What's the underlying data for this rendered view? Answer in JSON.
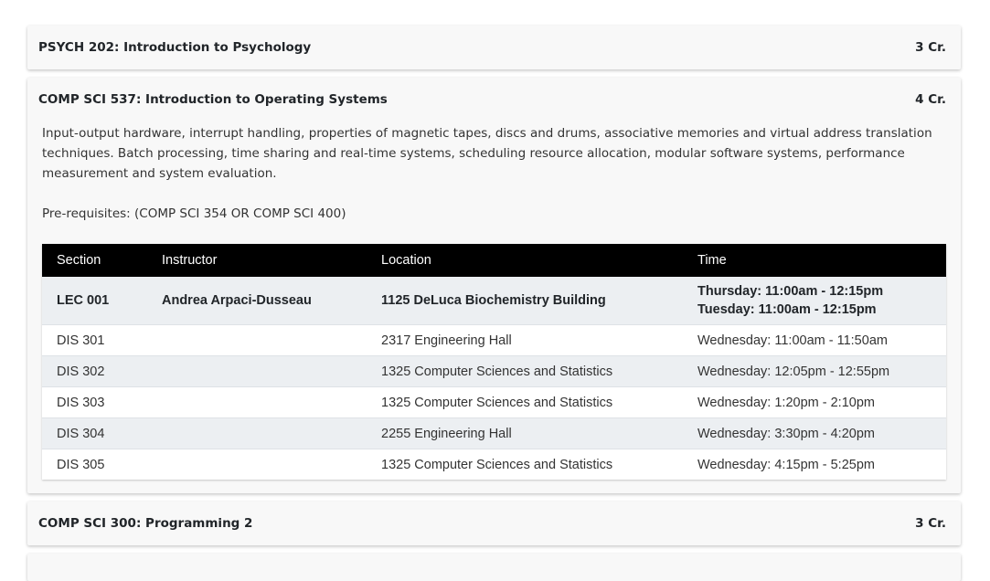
{
  "courses": [
    {
      "title": "PSYCH 202: Introduction to Psychology",
      "credits": "3 Cr."
    },
    {
      "title": "COMP SCI 537: Introduction to Operating Systems",
      "credits": "4 Cr.",
      "description": "Input-output hardware, interrupt handling, properties of magnetic tapes, discs and drums, associative memories and virtual address translation techniques. Batch processing, time sharing and real-time systems, scheduling resource allocation, modular software systems, performance measurement and system evaluation.",
      "prerequisites": "Pre-requisites: (COMP SCI 354 OR COMP SCI 400)"
    },
    {
      "title": "COMP SCI 300: Programming 2",
      "credits": "3 Cr."
    }
  ],
  "table": {
    "headers": {
      "section": "Section",
      "instructor": "Instructor",
      "location": "Location",
      "time": "Time"
    },
    "lecture": {
      "section": "LEC 001",
      "instructor": "Andrea Arpaci-Dusseau",
      "location": "1125 DeLuca Biochemistry Building",
      "times": [
        "Thursday: 11:00am - 12:15pm",
        "Tuesday: 11:00am - 12:15pm"
      ]
    },
    "rows": [
      {
        "section": "DIS 301",
        "instructor": "",
        "location": "2317 Engineering Hall",
        "time": "Wednesday: 11:00am - 11:50am"
      },
      {
        "section": "DIS 302",
        "instructor": "",
        "location": "1325 Computer Sciences and Statistics",
        "time": "Wednesday: 12:05pm - 12:55pm"
      },
      {
        "section": "DIS 303",
        "instructor": "",
        "location": "1325 Computer Sciences and Statistics",
        "time": "Wednesday: 1:20pm - 2:10pm"
      },
      {
        "section": "DIS 304",
        "instructor": "",
        "location": "2255 Engineering Hall",
        "time": "Wednesday: 3:30pm - 4:20pm"
      },
      {
        "section": "DIS 305",
        "instructor": "",
        "location": "1325 Computer Sciences and Statistics",
        "time": "Wednesday: 4:15pm - 5:25pm"
      }
    ]
  }
}
